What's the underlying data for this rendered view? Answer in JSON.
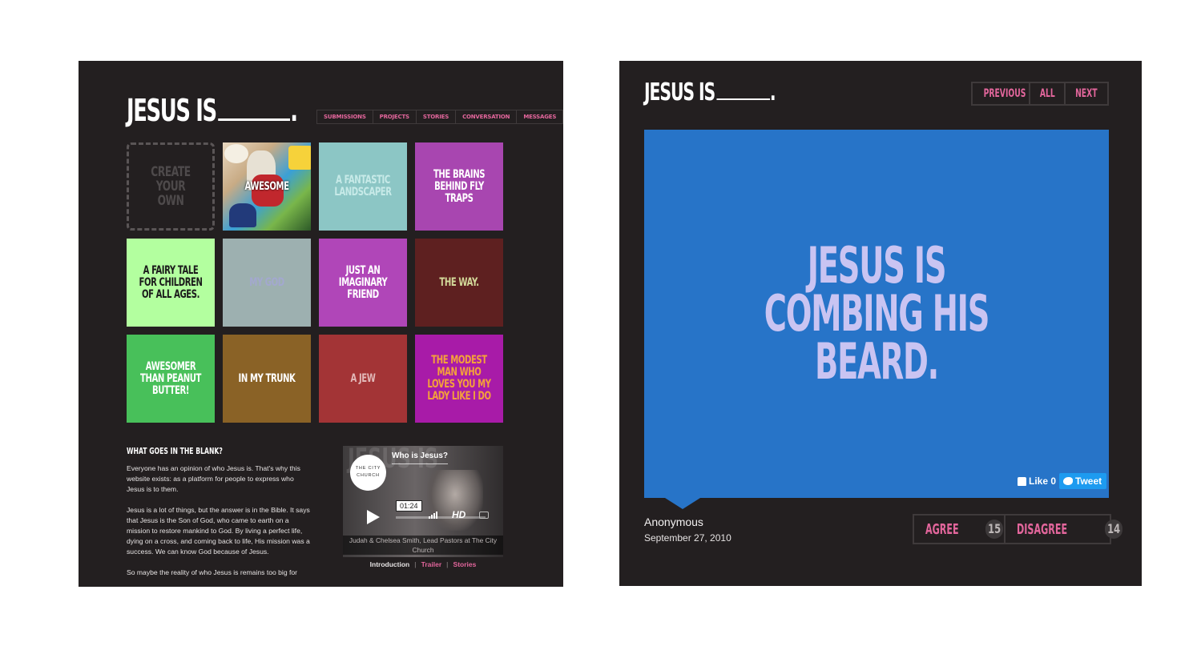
{
  "left": {
    "logo": "JESUS IS",
    "nav": [
      "SUBMISSIONS",
      "PROJECTS",
      "STORIES",
      "CONVERSATION",
      "MESSAGES"
    ],
    "create_tile": "CREATE YOUR OWN",
    "tiles": [
      {
        "text": "AWESOME",
        "bg": "#d9c5a3",
        "color": "#ffffff"
      },
      {
        "text": "A FANTASTIC LANDSCAPER",
        "bg": "#8cc6c5",
        "color": "#c7eae8"
      },
      {
        "text": "THE BRAINS BEHIND FLY TRAPS",
        "bg": "#a846b0",
        "color": "#ffffff"
      },
      {
        "text": "A FAIRY TALE FOR CHILDREN OF ALL AGES.",
        "bg": "#b3ff9f",
        "color": "#1b1b1b"
      },
      {
        "text": "MY GOD",
        "bg": "#9db0b0",
        "color": "#a3a8cf"
      },
      {
        "text": "JUST AN IMAGINARY FRIEND",
        "bg": "#b046b8",
        "color": "#ffffff"
      },
      {
        "text": "THE WAY.",
        "bg": "#5e2020",
        "color": "#d3d99a"
      },
      {
        "text": "AWESOMER THAN PEANUT BUTTER!",
        "bg": "#48c05a",
        "color": "#ffffff"
      },
      {
        "text": "IN MY TRUNK",
        "bg": "#8a6226",
        "color": "#ffffff"
      },
      {
        "text": "A JEW",
        "bg": "#a33436",
        "color": "#e2b8b8"
      },
      {
        "text": "THE MODEST MAN WHO LOVES YOU MY LADY LIKE I DO",
        "bg": "#a81ba8",
        "color": "#f4a13a"
      }
    ],
    "about_title": "WHAT GOES IN THE BLANK?",
    "about_paragraphs": [
      "Everyone has an opinion of who Jesus is. That's why this website exists: as a platform for people to express who Jesus is to them.",
      "Jesus is a lot of things, but the answer is in the Bible. It says that Jesus is the Son of God, who came to earth on a mission to restore mankind to God. By living a perfect life, dying on a cross, and coming back to life, His mission was a success. We can know God because of Jesus.",
      "So maybe the reality of who Jesus is remains too big for"
    ],
    "video": {
      "bg_text": "JESUS IS",
      "badge": "THE CITY CHURCH",
      "title": "Who is Jesus?",
      "time": "01:24",
      "hd": "HD",
      "caption": "Judah & Chelsea Smith, Lead Pastors at The City Church"
    },
    "video_tabs": {
      "intro": "Introduction",
      "trailer": "Trailer",
      "stories": "Stories",
      "sep": "|"
    }
  },
  "right": {
    "logo": "JESUS IS",
    "nav": {
      "previous": "PREVIOUS",
      "all": "ALL",
      "next": "NEXT"
    },
    "card_text": "JESUS IS COMBING HIS BEARD.",
    "card_color": "#2774c8",
    "like_label": "Like 0",
    "tweet_label": "Tweet",
    "author": "Anonymous",
    "date": "September 27, 2010",
    "agree_label": "AGREE",
    "agree_count": "15",
    "disagree_label": "DISAGREE",
    "disagree_count": "14"
  },
  "colors": {
    "background": "#231f20",
    "accent": "#e3669c"
  }
}
